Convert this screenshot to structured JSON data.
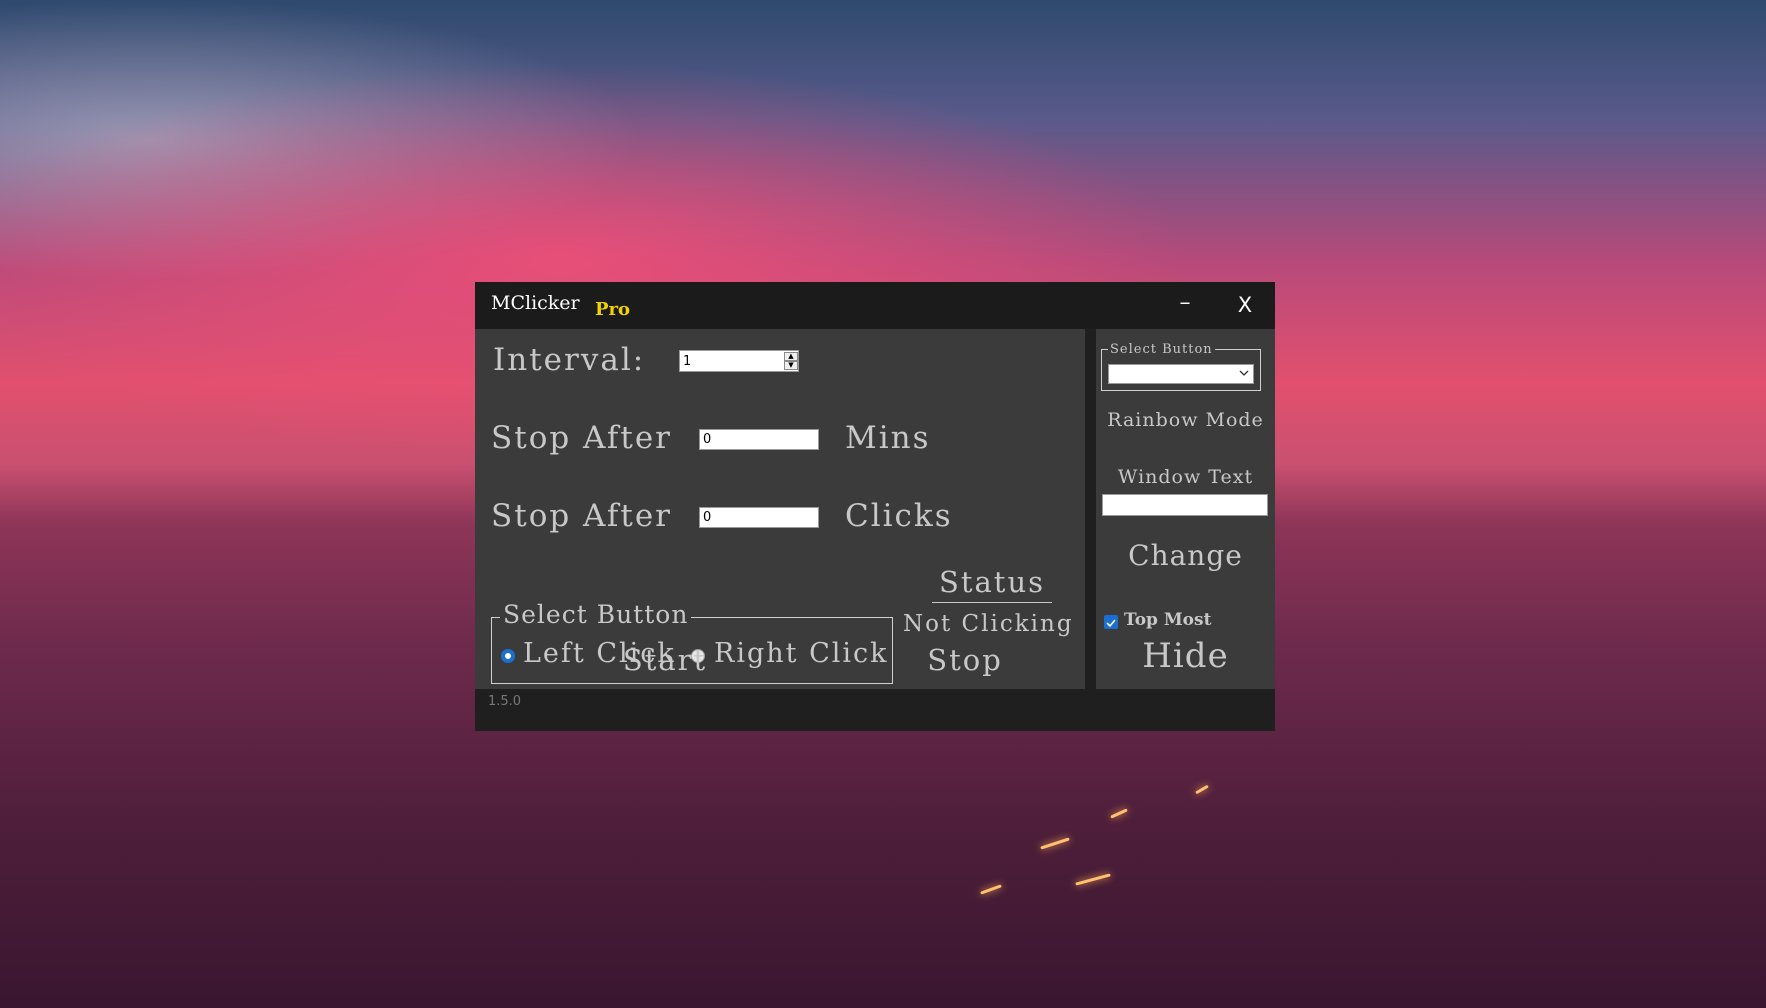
{
  "window": {
    "title": "MClicker",
    "badge": "Pro",
    "minimize_label": "–",
    "close_label": "X",
    "version": "1.5.0"
  },
  "main": {
    "interval_label": "Interval:",
    "interval_value": "1",
    "stop_after_mins_label": "Stop After",
    "stop_after_mins_value": "0",
    "mins_unit": "Mins",
    "stop_after_clicks_label": "Stop After",
    "stop_after_clicks_value": "0",
    "clicks_unit": "Clicks",
    "select_button_legend": "Select Button",
    "left_click_label": "Left Click",
    "right_click_label": "Right Click",
    "selected_button": "Left Click",
    "status_heading": "Status",
    "status_value": "Not Clicking",
    "start_label": "Start",
    "stop_label": "Stop"
  },
  "side": {
    "select_button_legend": "Select Button",
    "select_button_value": "",
    "rainbow_mode_label": "Rainbow Mode",
    "window_text_label": "Window Text",
    "window_text_value": "",
    "change_label": "Change",
    "top_most_label": "Top Most",
    "top_most_checked": true,
    "hide_label": "Hide"
  },
  "colors": {
    "panel_bg": "#3b3b3b",
    "titlebar_bg": "#1b1b1b",
    "text": "#c8c8c8",
    "pro_badge": "#f2d200",
    "accent": "#1a6fd0"
  }
}
